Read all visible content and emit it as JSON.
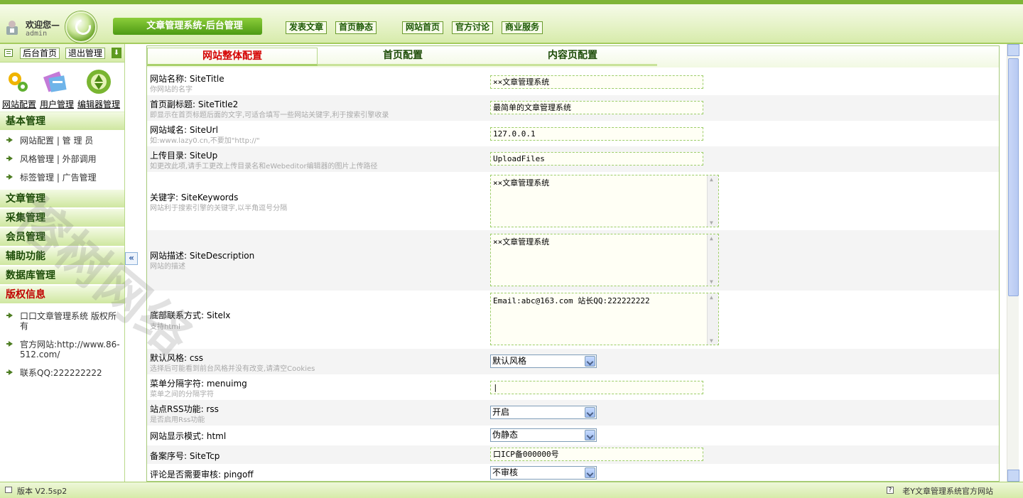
{
  "header": {
    "welcome": "欢迎您—",
    "username": "admin",
    "system_title": "文章管理系统-后台管理",
    "nav": [
      "发表文章",
      "首页静态",
      "网站首页",
      "官方讨论",
      "商业服务"
    ]
  },
  "sidebar": {
    "top_buttons": [
      "后台首页",
      "退出管理"
    ],
    "quick_links": [
      "网站配置",
      "用户管理",
      "编辑器管理"
    ],
    "menus": [
      {
        "label": "基本管理",
        "items": [
          "网站配置 | 管 理 员",
          "风格管理 | 外部调用",
          "标签管理 | 广告管理"
        ]
      },
      {
        "label": "文章管理"
      },
      {
        "label": "采集管理"
      },
      {
        "label": "会员管理"
      },
      {
        "label": "辅助功能"
      },
      {
        "label": "数据库管理"
      },
      {
        "label": "版权信息",
        "items": [
          "口口文章管理系统 版权所有",
          "官方网站:http://www.86-512.com/",
          "联系QQ:222222222"
        ]
      }
    ]
  },
  "tabs": [
    "网站整体配置",
    "首页配置",
    "内容页配置"
  ],
  "form": [
    {
      "label": "网站名称: SiteTitle",
      "hint": "你网站的名字",
      "type": "input",
      "value": "××文章管理系统"
    },
    {
      "label": "首页副标题: SiteTitle2",
      "hint": "即显示在首页标题后面的文字,可适合填写一些网站关键字,利于搜索引擎收录",
      "type": "input",
      "value": "最简单的文章管理系统"
    },
    {
      "label": "网站域名: SiteUrl",
      "hint": "如:www.lazy0.cn,不要加\"http://\"",
      "type": "input",
      "value": "127.0.0.1"
    },
    {
      "label": "上传目录: SiteUp",
      "hint": "如更改此项,请手工更改上传目录名和eWebeditor编辑器的图片上传路径",
      "type": "input",
      "value": "UploadFiles"
    },
    {
      "label": "关键字: SiteKeywords",
      "hint": "网站利于搜索引擎的关键字,以半角逗号分隔",
      "type": "textarea",
      "value": "××文章管理系统"
    },
    {
      "label": "网站描述: SiteDescription",
      "hint": "网站的描述",
      "type": "textarea",
      "value": "××文章管理系统"
    },
    {
      "label": "底部联系方式: Sitelx",
      "hint": "支持html",
      "type": "textarea",
      "value": "Email:abc@163.com 站长QQ:222222222"
    },
    {
      "label": "默认风格: css",
      "hint": "选择后可能看到前台风格并没有改变,请清空Cookies",
      "type": "select",
      "value": "默认风格"
    },
    {
      "label": "菜单分隔字符: menuimg",
      "hint": "菜单之间的分隔字符",
      "type": "input",
      "value": "|"
    },
    {
      "label": "站点RSS功能: rss",
      "hint": "是否启用Rss功能",
      "type": "select",
      "value": "开启"
    },
    {
      "label": "网站显示模式: html",
      "hint": "",
      "type": "select",
      "value": "伪静态"
    },
    {
      "label": "备案序号: SiteTcp",
      "hint": "",
      "type": "input",
      "value": "口ICP备000000号"
    },
    {
      "label": "评论是否需要审核: pingoff",
      "hint": "",
      "type": "select",
      "value": "不审核"
    }
  ],
  "footer": {
    "version": "版本 V2.5sp2",
    "site_link": "老Y文章管理系统官方网站"
  },
  "watermark": "榕树网络",
  "colors": {
    "accent": "#5e9a20",
    "active_tab": "#d40000",
    "menu_red": "#c00000"
  }
}
